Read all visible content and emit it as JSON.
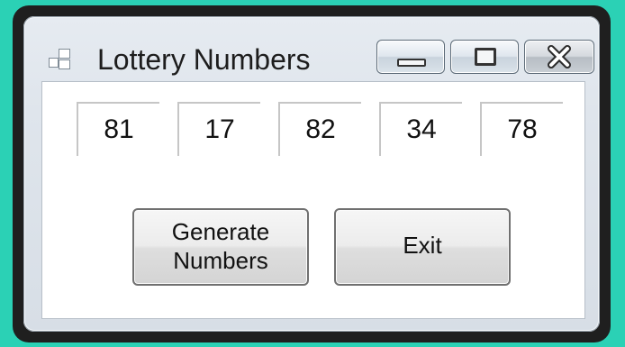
{
  "window": {
    "title": "Lottery Numbers",
    "icon": "app-window-icon",
    "controls": {
      "minimize_icon": "minimize-icon",
      "maximize_icon": "maximize-icon",
      "close_icon": "close-icon"
    }
  },
  "numbers": [
    "81",
    "17",
    "82",
    "34",
    "78"
  ],
  "buttons": {
    "generate_line1": "Generate",
    "generate_line2": "Numbers",
    "exit": "Exit"
  },
  "colors": {
    "background": "#2bd1b5",
    "close_cross": "#ffffff"
  }
}
